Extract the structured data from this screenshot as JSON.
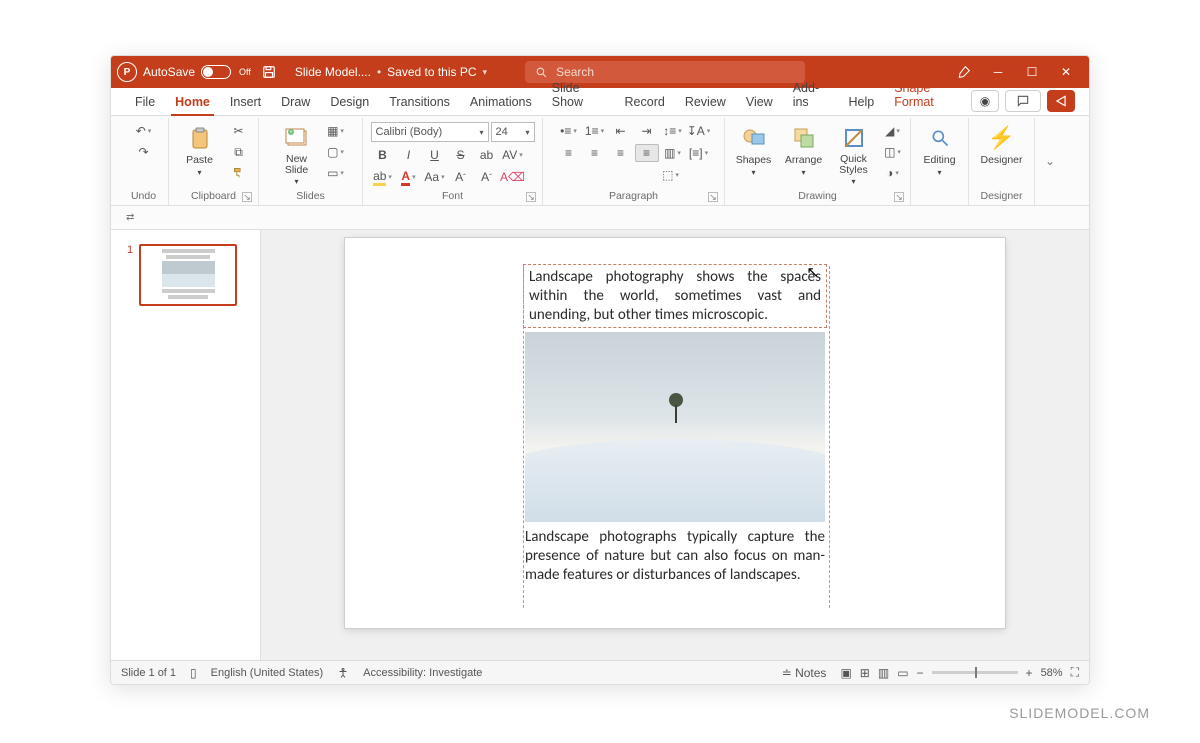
{
  "titlebar": {
    "autosave_label": "AutoSave",
    "autosave_state": "Off",
    "doc_name": "Slide Model....",
    "save_status": "Saved to this PC",
    "search_placeholder": "Search"
  },
  "menu": {
    "tabs": [
      "File",
      "Home",
      "Insert",
      "Draw",
      "Design",
      "Transitions",
      "Animations",
      "Slide Show",
      "Record",
      "Review",
      "View",
      "Add-ins",
      "Help"
    ],
    "active_index": 1,
    "context_tab": "Shape Format"
  },
  "ribbon": {
    "undo_label": "Undo",
    "clipboard": {
      "paste": "Paste",
      "label": "Clipboard"
    },
    "slides": {
      "new_slide": "New\nSlide",
      "label": "Slides"
    },
    "font": {
      "name_value": "Calibri (Body)",
      "size_value": "24",
      "label": "Font"
    },
    "paragraph": {
      "label": "Paragraph"
    },
    "drawing": {
      "shapes": "Shapes",
      "arrange": "Arrange",
      "quick_styles": "Quick\nStyles",
      "label": "Drawing"
    },
    "editing": {
      "label": "Editing",
      "btn": "Editing"
    },
    "designer": {
      "label": "Designer",
      "btn": "Designer"
    }
  },
  "thumbnails": {
    "slide1_num": "1"
  },
  "slide": {
    "text_top": "Landscape photography shows the spaces within the world, sometimes vast and unending, but other times microscopic.",
    "text_bottom": "Landscape photographs typically capture the presence of nature but can also focus on man-made features or disturbances of landscapes."
  },
  "status": {
    "slide_counter": "Slide 1 of 1",
    "language": "English (United States)",
    "accessibility": "Accessibility: Investigate",
    "notes": "Notes",
    "zoom": "58%"
  },
  "watermark": "SLIDEMODEL.COM"
}
